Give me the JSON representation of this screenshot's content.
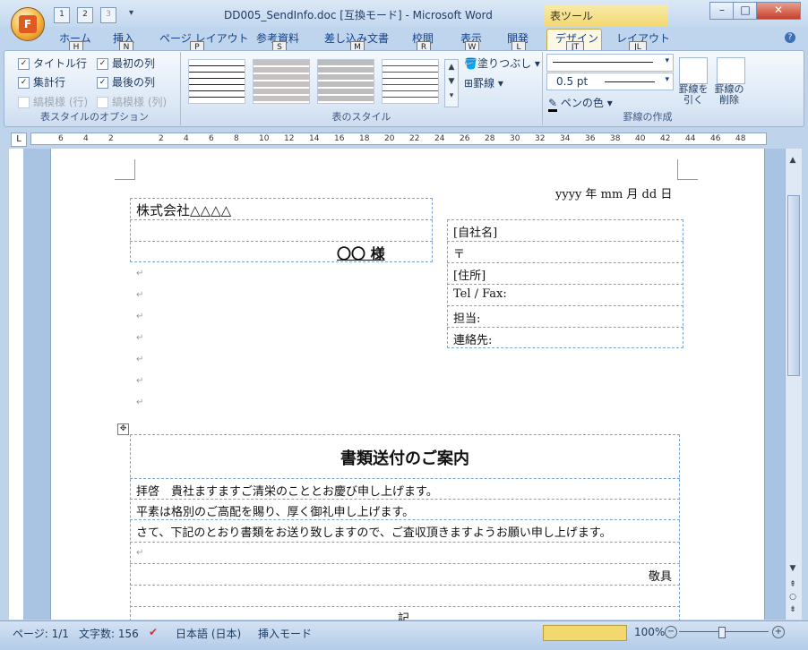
{
  "title_bar": {
    "document_title": "DD005_SendInfo.doc [互換モード] - Microsoft Word",
    "tool_tab_label": "表ツール",
    "qat": [
      "1",
      "2",
      "3"
    ]
  },
  "tabs": [
    {
      "label": "ホーム",
      "key": "H"
    },
    {
      "label": "挿入",
      "key": "N"
    },
    {
      "label": "ページ レイアウト",
      "key": "P"
    },
    {
      "label": "参考資料",
      "key": "S"
    },
    {
      "label": "差し込み文書",
      "key": "M"
    },
    {
      "label": "校閲",
      "key": "R"
    },
    {
      "label": "表示",
      "key": "W"
    },
    {
      "label": "開発",
      "key": "L"
    },
    {
      "label": "デザイン",
      "key": "JT"
    },
    {
      "label": "レイアウト",
      "key": "JL"
    }
  ],
  "ribbon": {
    "style_options": {
      "label": "表スタイルのオプション",
      "items": [
        {
          "label": "タイトル行",
          "checked": true,
          "enabled": true
        },
        {
          "label": "最初の列",
          "checked": true,
          "enabled": true
        },
        {
          "label": "集計行",
          "checked": true,
          "enabled": true
        },
        {
          "label": "最後の列",
          "checked": true,
          "enabled": true
        },
        {
          "label": "縞模様 (行)",
          "checked": false,
          "enabled": false
        },
        {
          "label": "縞模様 (列)",
          "checked": false,
          "enabled": false
        }
      ]
    },
    "table_styles": {
      "label": "表のスタイル",
      "shading": "塗りつぶし",
      "borders": "罫線"
    },
    "draw_borders": {
      "label": "罫線の作成",
      "line_weight": "0.5 pt",
      "pen_color": "ペンの色",
      "draw_table": "罫線を引く",
      "eraser": "罫線の削除"
    }
  },
  "ruler": {
    "ticks": [
      "6",
      "4",
      "2",
      "",
      "2",
      "4",
      "6",
      "8",
      "10",
      "12",
      "14",
      "16",
      "18",
      "20",
      "22",
      "24",
      "26",
      "28",
      "30",
      "32",
      "34",
      "36",
      "38",
      "40",
      "42",
      "44",
      "46",
      "48"
    ]
  },
  "document": {
    "date_line": "yyyy 年 mm 月 dd 日",
    "recipient_company": "株式会社△△△△",
    "recipient_name": "〇〇 様",
    "sender_fields": [
      "[自社名]",
      "〒",
      "[住所]",
      "Tel / Fax: ",
      "担当:",
      "連絡先:"
    ],
    "heading": "書類送付のご案内",
    "body_lines": [
      "拝啓　貴社ますますご清栄のこととお慶び申し上げます。",
      "平素は格別のご高配を賜り、厚く御礼申し上げます。",
      "さて、下記のとおり書類をお送り致しますので、ご査収頂きますようお願い申し上げます。",
      ""
    ],
    "closing": "敬具",
    "note_heading": "記",
    "para_mark": "↵"
  },
  "status_bar": {
    "page": "ページ: 1/1",
    "word_count": "文字数: 156",
    "language": "日本語 (日本)",
    "mode": "挿入モード",
    "zoom": "100%"
  },
  "colors": {
    "accent": "#15428b",
    "tool_tab": "#f3d870",
    "page_bg": "#ffffff",
    "workspace": "#a9c3e3"
  }
}
